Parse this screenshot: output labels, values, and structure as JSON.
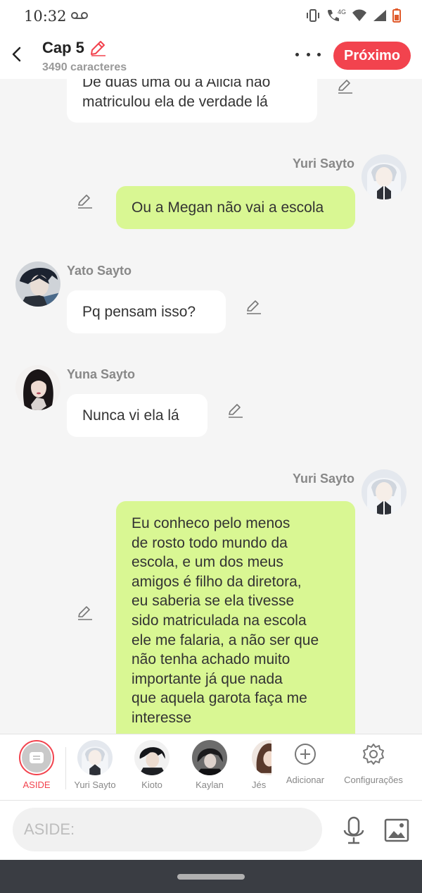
{
  "status_bar": {
    "time": "10:32",
    "network": "4G"
  },
  "header": {
    "title": "Cap 5",
    "subtitle": "3490 caracteres",
    "next_label": "Próximo",
    "accent_color": "#f2434e"
  },
  "messages": [
    {
      "side": "left",
      "sender": "",
      "lines": [
        "De duas uma ou a Alicia não",
        "matriculou ela de verdade lá"
      ]
    },
    {
      "side": "right",
      "sender": "Yuri Sayto",
      "lines": [
        "Ou a Megan não vai a escola"
      ]
    },
    {
      "side": "left",
      "sender": "Yato Sayto",
      "lines": [
        "Pq pensam isso?"
      ]
    },
    {
      "side": "left",
      "sender": "Yuna Sayto",
      "lines": [
        "Nunca vi ela lá"
      ]
    },
    {
      "side": "right",
      "sender": "Yuri Sayto",
      "lines": [
        "Eu conheco pelo menos",
        "de rosto todo mundo da",
        "escola, e um dos meus",
        "amigos é filho da diretora,",
        "eu saberia se ela tivesse",
        "sido matriculada na escola",
        "ele me falaria, a não ser que",
        "não tenha achado muito",
        "importante já que nada",
        "que aquela garota faça me",
        "interesse"
      ]
    }
  ],
  "character_bar": {
    "aside_label": "ASIDE",
    "characters": [
      "Yuri Sayto",
      "Kioto",
      "Kaylan",
      "Jés"
    ],
    "add_label": "Adicionar",
    "settings_label": "Configurações"
  },
  "input": {
    "placeholder": "ASIDE:"
  },
  "colors": {
    "left_bubble": "#ffffff",
    "right_bubble": "#d9f793",
    "background": "#f5f5f5"
  }
}
